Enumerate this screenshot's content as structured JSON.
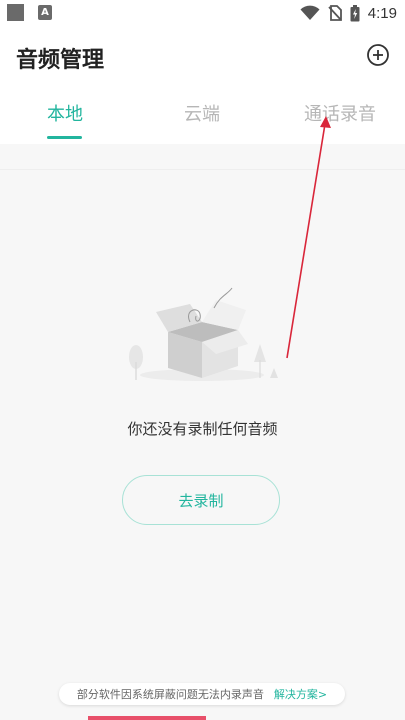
{
  "status_bar": {
    "time": "4:19",
    "notification_icon_letter": "A",
    "icons": [
      "screenshot-icon",
      "a-notification-icon",
      "wifi-icon",
      "no-sim-icon",
      "battery-icon"
    ]
  },
  "header": {
    "title": "音频管理",
    "add_icon": "plus-circle-icon"
  },
  "tabs": [
    {
      "label": "本地",
      "active": true
    },
    {
      "label": "云端",
      "active": false
    },
    {
      "label": "通话录音",
      "active": false
    }
  ],
  "empty_state": {
    "illustration": "empty-box-illustration",
    "message": "你还没有录制任何音频",
    "button_label": "去录制"
  },
  "tip": {
    "text": "部分软件因系统屏蔽问题无法内录声音",
    "link": "解决方案>"
  },
  "colors": {
    "accent": "#22b59e",
    "annotation_arrow": "#d9263a",
    "bottom_accent": "#e8506a"
  }
}
